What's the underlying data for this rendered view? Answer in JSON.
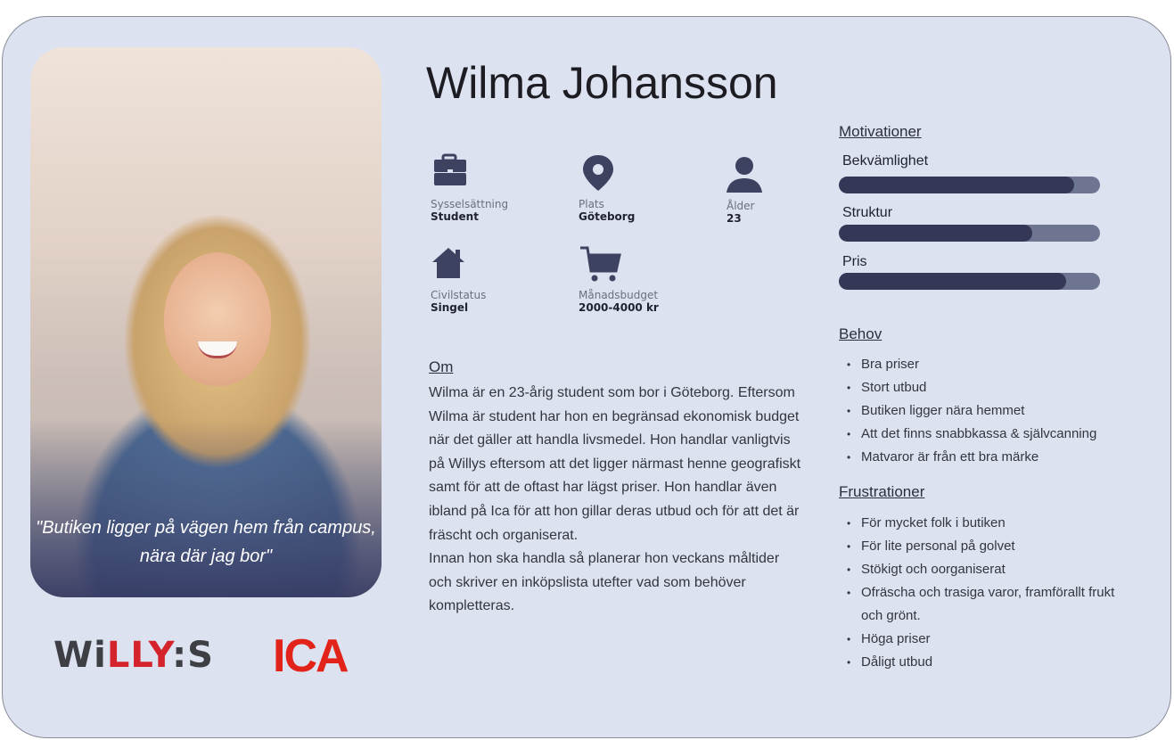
{
  "persona": {
    "name": "Wilma Johansson",
    "quote": "\"Butiken ligger på vägen hem från campus, nära där jag bor\""
  },
  "info": {
    "occupation": {
      "label": "Sysselsättning",
      "value": "Student",
      "icon": "briefcase-icon"
    },
    "location": {
      "label": "Plats",
      "value": "Göteborg",
      "icon": "map-pin-icon"
    },
    "age": {
      "label": "Ålder",
      "value": "23",
      "icon": "user-icon"
    },
    "civil_status": {
      "label": "Civilstatus",
      "value": "Singel",
      "icon": "home-icon"
    },
    "budget": {
      "label": "Månadsbudget",
      "value": "2000-4000 kr",
      "icon": "shopping-cart-icon"
    }
  },
  "about": {
    "title": "Om",
    "paragraphs": [
      "Wilma är en 23-årig student som bor i Göteborg. Eftersom Wilma är student har hon en begränsad ekonomisk budget när det gäller att handla livsmedel. Hon handlar vanligtvis på Willys eftersom att det ligger närmast henne geografiskt samt för att de oftast har lägst priser. Hon handlar även ibland på Ica för att hon gillar deras utbud och för att det är fräscht och organiserat.",
      "Innan hon ska handla så planerar hon veckans måltider och skriver en inköpslista utefter vad som behöver kompletteras."
    ]
  },
  "motivations": {
    "title": "Motivationer",
    "items": [
      {
        "label": "Bekvämlighet",
        "level": 0.9
      },
      {
        "label": "Struktur",
        "level": 0.74
      },
      {
        "label": "Pris",
        "level": 0.87
      }
    ]
  },
  "needs": {
    "title": "Behov",
    "items": [
      "Bra priser",
      "Stort utbud",
      "Butiken ligger nära hemmet",
      "Att det finns snabbkassa & självcanning",
      "Matvaror är från ett bra märke"
    ]
  },
  "frustrations": {
    "title": "Frustrationer",
    "items": [
      "För mycket folk i butiken",
      "För lite personal på golvet",
      "Stökigt och oorganiserat",
      "Ofräscha och trasiga varor, framförallt frukt och grönt.",
      "Höga priser",
      "Dåligt utbud"
    ]
  },
  "logos": {
    "willys": "WiLLY:S",
    "ica": "ICA"
  },
  "colors": {
    "card_bg": "#dde2f0",
    "icon": "#3d4260",
    "bar_fill": "#353757",
    "bar_track": "#6d7590",
    "ica_red": "#e2231a"
  }
}
